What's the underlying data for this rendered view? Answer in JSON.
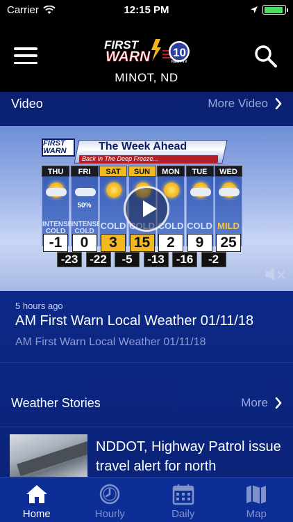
{
  "status_bar": {
    "carrier": "Carrier",
    "time": "12:15 PM",
    "battery_level": 0.9
  },
  "header": {
    "logo_text": "FIRST WARN",
    "station_channel": "10",
    "station_call": "KMOT-TV",
    "location": "MINOT, ND"
  },
  "video_section": {
    "title": "Video",
    "more_label": "More Video",
    "video": {
      "banner_logo": "FIRST WARN",
      "banner_title": "The Week Ahead",
      "banner_subtitle": "Back In The Deep Freeze...",
      "days": [
        {
          "name": "THU",
          "icon": "sun-cloud-icon",
          "condition": "INTENSE COLD",
          "high": "-1",
          "low": "-23",
          "highlight": false
        },
        {
          "name": "FRI",
          "icon": "cloud-icon",
          "precip": "50%",
          "condition": "INTENSE COLD",
          "high": "0",
          "low": "-22",
          "highlight": false
        },
        {
          "name": "SAT",
          "icon": "sun-icon",
          "condition": "COLD",
          "high": "3",
          "low": "-5",
          "highlight": true
        },
        {
          "name": "SUN",
          "icon": "sun-icon",
          "condition": "COLD",
          "high": "15",
          "low": "-13",
          "highlight": true
        },
        {
          "name": "MON",
          "icon": "sun-icon",
          "condition": "COLD",
          "high": "2",
          "low": "-16",
          "highlight": false
        },
        {
          "name": "TUE",
          "icon": "sun-cloud-icon",
          "condition": "COLD",
          "high": "9",
          "low": "-2",
          "highlight": false
        },
        {
          "name": "WED",
          "icon": "sun-cloud-icon",
          "condition": "MILD",
          "high": "25",
          "low": "",
          "highlight": false
        }
      ]
    },
    "timestamp": "5 hours ago",
    "headline": "AM First Warn Local Weather 01/11/18",
    "subheadline": "AM First Warn Local Weather 01/11/18"
  },
  "stories_section": {
    "title": "Weather Stories",
    "more_label": "More",
    "story": {
      "title": "NDDOT, Highway Patrol issue travel alert for north"
    }
  },
  "tab_bar": {
    "tabs": [
      {
        "label": "Home",
        "icon": "home-icon",
        "active": true
      },
      {
        "label": "Hourly",
        "icon": "clock-icon",
        "active": false
      },
      {
        "label": "Daily",
        "icon": "calendar-icon",
        "active": false
      },
      {
        "label": "Map",
        "icon": "map-icon",
        "active": false
      }
    ]
  },
  "colors": {
    "header_bg": "#000000",
    "content_bg": "#0c2a8a",
    "tab_bar_bg": "#0d2e97",
    "accent_gold": "#f1b91f"
  }
}
